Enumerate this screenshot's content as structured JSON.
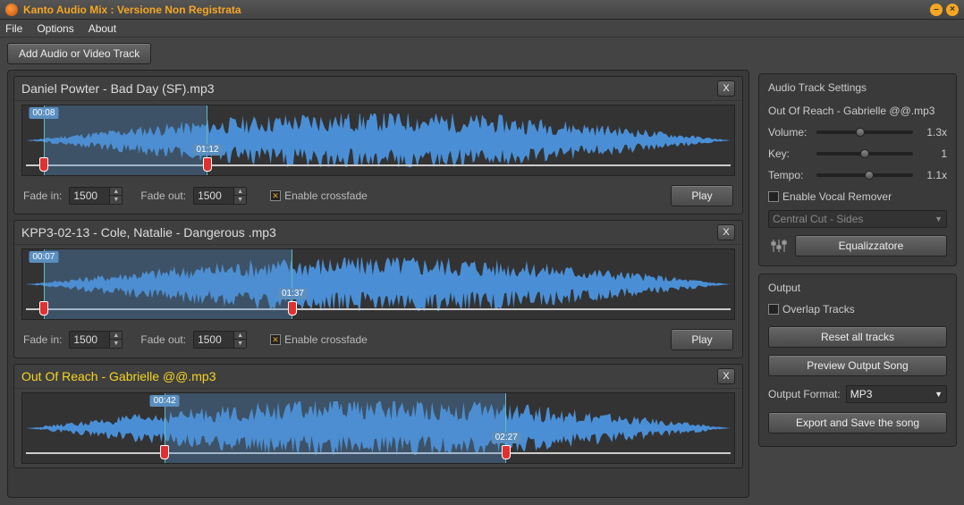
{
  "title": "Kanto Audio Mix : Versione Non Registrata",
  "menu": {
    "file": "File",
    "options": "Options",
    "about": "About"
  },
  "toolbar": {
    "add_track": "Add Audio or Video Track"
  },
  "tracks": [
    {
      "title": "Daniel Powter - Bad Day (SF).mp3",
      "selected": false,
      "fade_in_label": "Fade in:",
      "fade_in": "1500",
      "fade_out_label": "Fade out:",
      "fade_out": "1500",
      "crossfade_label": "Enable crossfade",
      "crossfade": true,
      "play": "Play",
      "sel_start_pct": 3,
      "sel_end_pct": 26,
      "start_time": "00:08",
      "end_time": "01:12"
    },
    {
      "title": "KPP3-02-13 - Cole, Natalie - Dangerous .mp3",
      "selected": false,
      "fade_in_label": "Fade in:",
      "fade_in": "1500",
      "fade_out_label": "Fade out:",
      "fade_out": "1500",
      "crossfade_label": "Enable crossfade",
      "crossfade": true,
      "play": "Play",
      "sel_start_pct": 3,
      "sel_end_pct": 38,
      "start_time": "00:07",
      "end_time": "01:37"
    },
    {
      "title": "Out Of Reach - Gabrielle @@.mp3",
      "selected": true,
      "sel_start_pct": 20,
      "sel_end_pct": 68,
      "start_time": "00:42",
      "end_time": "02:27"
    }
  ],
  "close_label": "X",
  "settings": {
    "legend": "Audio Track Settings",
    "track_name": "Out Of Reach - Gabrielle @@.mp3",
    "volume_label": "Volume:",
    "volume_pct": 45,
    "volume_val": "1.3x",
    "key_label": "Key:",
    "key_pct": 50,
    "key_val": "1",
    "tempo_label": "Tempo:",
    "tempo_pct": 55,
    "tempo_val": "1.1x",
    "vocal_remover_label": "Enable Vocal Remover",
    "vocal_remover": false,
    "vocal_mode": "Central Cut - Sides",
    "eq_btn": "Equalizzatore"
  },
  "output": {
    "legend": "Output",
    "overlap_label": "Overlap Tracks",
    "overlap": false,
    "reset": "Reset all tracks",
    "preview": "Preview Output Song",
    "format_label": "Output Format:",
    "format": "MP3",
    "export": "Export and Save the song"
  }
}
